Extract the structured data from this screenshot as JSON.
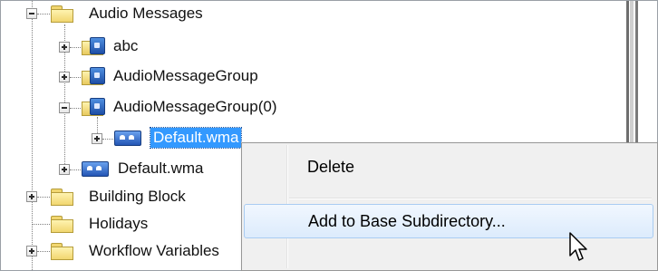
{
  "tree": {
    "items": [
      {
        "label": "Audio Messages",
        "icon": "folder-icon",
        "expander": "minus"
      },
      {
        "label": "abc",
        "icon": "message-group-icon",
        "expander": "plus"
      },
      {
        "label": "AudioMessageGroup",
        "icon": "message-group-icon",
        "expander": "plus"
      },
      {
        "label": "AudioMessageGroup(0)",
        "icon": "message-group-icon",
        "expander": "minus"
      },
      {
        "label": "Default.wma",
        "icon": "audio-file-icon",
        "expander": "plus",
        "selected": true
      },
      {
        "label": "Default.wma",
        "icon": "audio-file-icon",
        "expander": "plus"
      },
      {
        "label": "Building Block",
        "icon": "folder-icon",
        "expander": "plus"
      },
      {
        "label": "Holidays",
        "icon": "folder-icon",
        "expander": "none"
      },
      {
        "label": "Workflow Variables",
        "icon": "folder-icon",
        "expander": "plus"
      }
    ]
  },
  "context_menu": {
    "items": [
      {
        "label": "Delete"
      },
      {
        "label": "Add to Base Subdirectory...",
        "hovered": true
      }
    ]
  },
  "colors": {
    "selection": "#3399ff",
    "menu_background": "#f0f0f0",
    "menu_highlight": "#dcebfc",
    "folder_yellow": "#f1d670"
  }
}
